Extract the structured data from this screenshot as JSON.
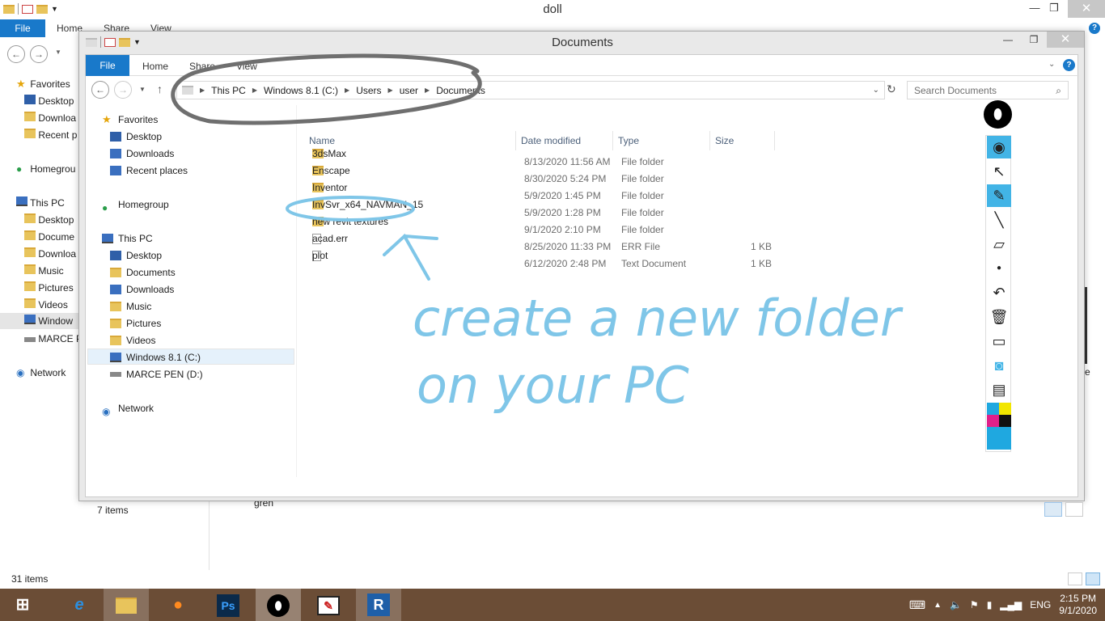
{
  "background_window": {
    "title": "doll",
    "tabs": [
      "Home",
      "Share",
      "View"
    ],
    "file_label": "File",
    "sidebar": [
      {
        "label": "Favorites",
        "icon": "star-icon"
      },
      {
        "label": "Desktop",
        "icon": "desktop-icon"
      },
      {
        "label": "Downloa",
        "icon": "downloads-icon"
      },
      {
        "label": "Recent p",
        "icon": "recent-icon"
      },
      {
        "label": "Homegrou",
        "icon": "homegroup-icon"
      },
      {
        "label": "This PC",
        "icon": "pc-icon"
      },
      {
        "label": "Desktop",
        "icon": "desktop-icon"
      },
      {
        "label": "Docume",
        "icon": "folder-icon"
      },
      {
        "label": "Downloa",
        "icon": "downloads-icon"
      },
      {
        "label": "Music",
        "icon": "folder-icon"
      },
      {
        "label": "Pictures",
        "icon": "folder-icon"
      },
      {
        "label": "Videos",
        "icon": "folder-icon"
      },
      {
        "label": "Window",
        "icon": "drive-icon"
      },
      {
        "label": "MARCE P",
        "icon": "usb-drive-icon"
      },
      {
        "label": "Network",
        "icon": "network-icon"
      }
    ],
    "status": "31 items",
    "partial_text": "gren",
    "partial_right": "e"
  },
  "window": {
    "title": "Documents",
    "file_label": "File",
    "tabs": [
      "Home",
      "Share",
      "View"
    ],
    "breadcrumb": [
      "This PC",
      "Windows 8.1 (C:)",
      "Users",
      "user",
      "Documents"
    ],
    "search_placeholder": "Search Documents",
    "nav": [
      {
        "label": "Favorites",
        "icon": "star-icon"
      },
      {
        "label": "Desktop",
        "icon": "desktop-icon"
      },
      {
        "label": "Downloads",
        "icon": "downloads-icon"
      },
      {
        "label": "Recent places",
        "icon": "recent-icon"
      },
      {
        "label": "Homegroup",
        "icon": "homegroup-icon"
      },
      {
        "label": "This PC",
        "icon": "pc-icon"
      },
      {
        "label": "Desktop",
        "icon": "desktop-icon"
      },
      {
        "label": "Documents",
        "icon": "folder-icon"
      },
      {
        "label": "Downloads",
        "icon": "downloads-icon"
      },
      {
        "label": "Music",
        "icon": "folder-icon"
      },
      {
        "label": "Pictures",
        "icon": "folder-icon"
      },
      {
        "label": "Videos",
        "icon": "folder-icon"
      },
      {
        "label": "Windows 8.1 (C:)",
        "icon": "drive-icon"
      },
      {
        "label": "MARCE PEN (D:)",
        "icon": "usb-drive-icon"
      },
      {
        "label": "Network",
        "icon": "network-icon"
      }
    ],
    "columns": [
      "Name",
      "Date modified",
      "Type",
      "Size"
    ],
    "files": [
      {
        "name": "3dsMax",
        "date": "8/13/2020 11:56 AM",
        "type": "File folder",
        "size": "",
        "icon": "folder-icon"
      },
      {
        "name": "Enscape",
        "date": "8/30/2020 5:24 PM",
        "type": "File folder",
        "size": "",
        "icon": "folder-icon"
      },
      {
        "name": "Inventor",
        "date": "5/9/2020 1:45 PM",
        "type": "File folder",
        "size": "",
        "icon": "folder-icon"
      },
      {
        "name": "InvSvr_x64_NAVMAN_15",
        "date": "5/9/2020 1:28 PM",
        "type": "File folder",
        "size": "",
        "icon": "folder-icon"
      },
      {
        "name": "new revit textures",
        "date": "9/1/2020 2:10 PM",
        "type": "File folder",
        "size": "",
        "icon": "folder-icon"
      },
      {
        "name": "acad.err",
        "date": "8/25/2020 11:33 PM",
        "type": "ERR File",
        "size": "1 KB",
        "icon": "file-icon"
      },
      {
        "name": "plot",
        "date": "6/12/2020 2:48 PM",
        "type": "Text Document",
        "size": "1 KB",
        "icon": "text-file-icon"
      }
    ],
    "status": "7 items"
  },
  "annotation": {
    "line1": "create a new folder",
    "line2": "on your PC",
    "ink_color": "#7fc6e8"
  },
  "toolbar": {
    "tools": [
      "eye-icon",
      "pointer-icon",
      "highlighter-icon",
      "pen-icon",
      "eraser-icon",
      "dot-icon",
      "undo-icon",
      "trash-icon",
      "board-icon",
      "camera-icon",
      "clipboard-icon"
    ],
    "colors": [
      "#1fa8e0",
      "#f2e600",
      "#e0208a",
      "#111111",
      "#1fa8e0"
    ]
  },
  "taskbar": {
    "apps": [
      "start-icon",
      "internet-explorer-icon",
      "file-explorer-icon",
      "firefox-icon",
      "photoshop-icon",
      "epic-pen-icon",
      "sketch-icon",
      "revit-icon"
    ],
    "ps_label": "Ps",
    "revit_label": "R",
    "lang": "ENG",
    "time": "2:15 PM",
    "date": "9/1/2020"
  }
}
